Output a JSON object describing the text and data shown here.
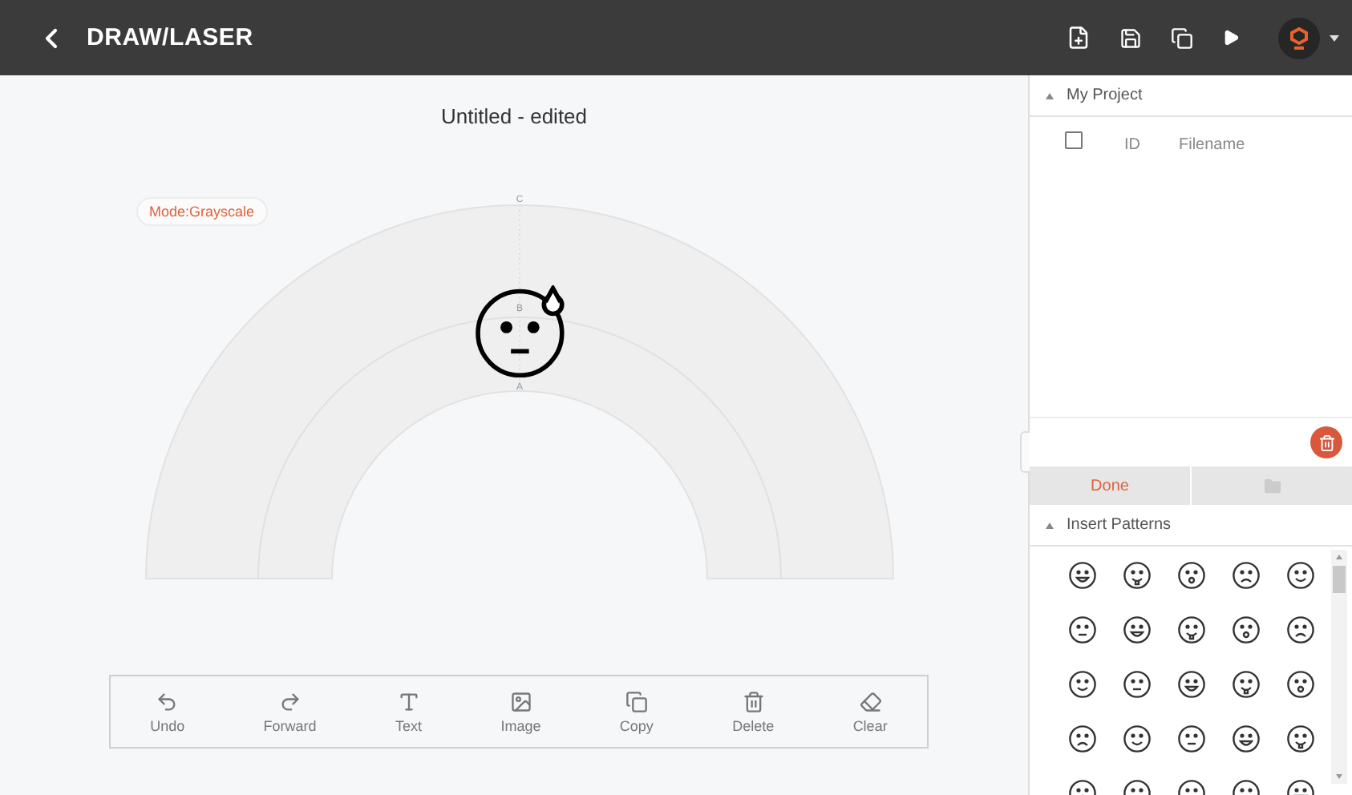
{
  "header": {
    "title": "DRAW/LASER"
  },
  "canvas": {
    "title": "Untitled - edited",
    "mode": "Mode:Grayscale",
    "ring_labels": [
      "C",
      "B",
      "A"
    ]
  },
  "toolbar": [
    {
      "kind": "undo",
      "label": "Undo"
    },
    {
      "kind": "forward",
      "label": "Forward"
    },
    {
      "kind": "text",
      "label": "Text"
    },
    {
      "kind": "image",
      "label": "Image"
    },
    {
      "kind": "copy",
      "label": "Copy"
    },
    {
      "kind": "delete",
      "label": "Delete"
    },
    {
      "kind": "clear",
      "label": "Clear"
    }
  ],
  "project": {
    "title": "My Project",
    "expanded": true,
    "select_all": {
      "checked": false
    },
    "columns": [
      "ID",
      "Filename"
    ],
    "done": "Done"
  },
  "patterns": {
    "title": "Insert Patterns",
    "expanded": true
  }
}
